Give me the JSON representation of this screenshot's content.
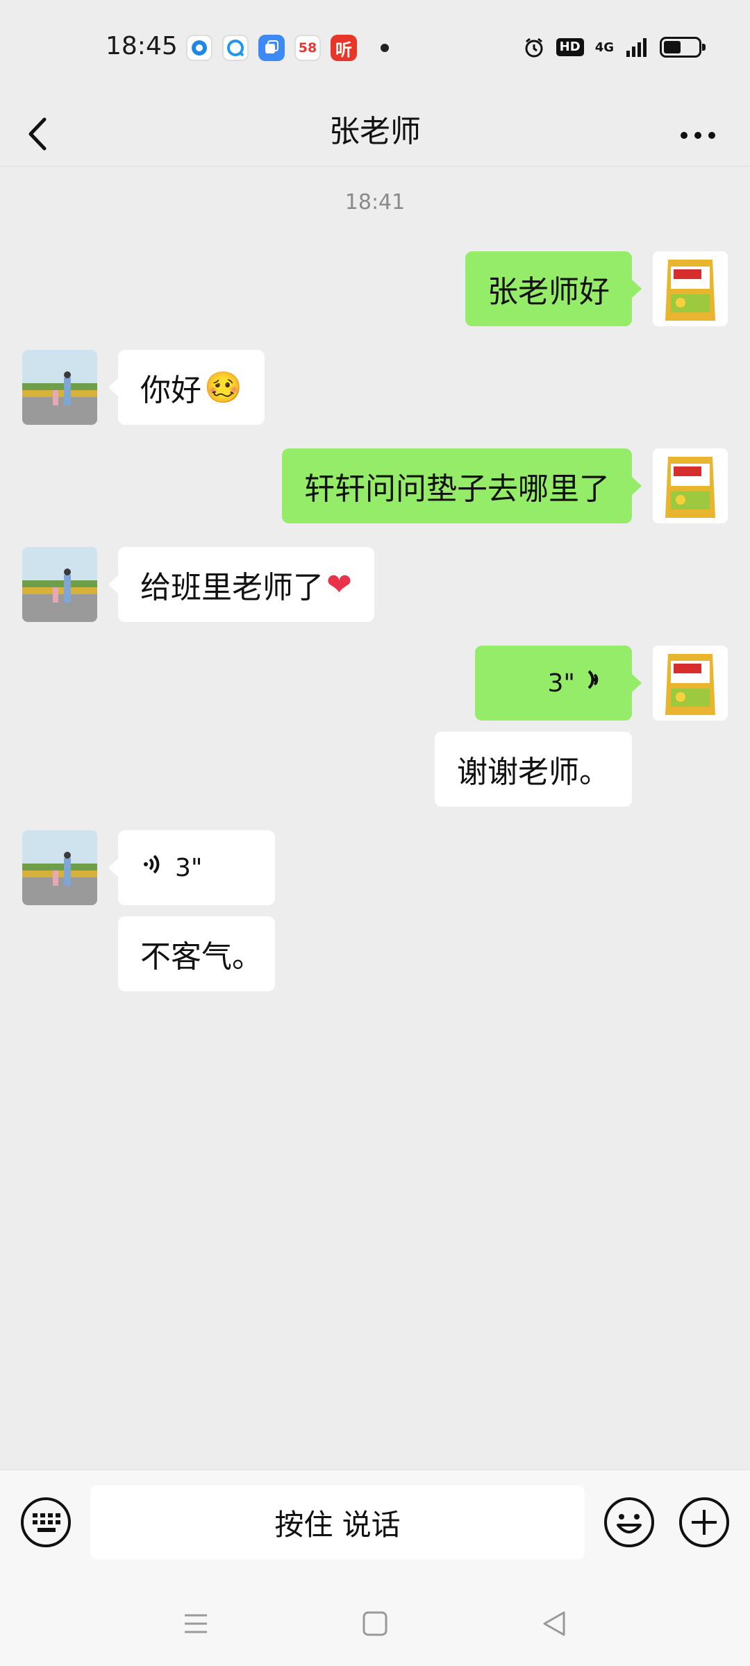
{
  "status_bar": {
    "time": "18:45",
    "apps": [
      "58",
      "听"
    ],
    "network": "4G"
  },
  "header": {
    "title": "张老师"
  },
  "chat": {
    "timestamp": "18:41",
    "messages": [
      {
        "from": "me",
        "type": "text",
        "text": "张老师好"
      },
      {
        "from": "other",
        "type": "text",
        "text": "你好",
        "emoji": "🥴"
      },
      {
        "from": "me",
        "type": "text",
        "text": "轩轩问问垫子去哪里了"
      },
      {
        "from": "other",
        "type": "text",
        "text": "给班里老师了",
        "emoji": "❤"
      },
      {
        "from": "me",
        "type": "voice",
        "duration": "3\""
      },
      {
        "from": "me",
        "type": "voice-transcript",
        "text": "谢谢老师。"
      },
      {
        "from": "other",
        "type": "voice",
        "duration": "3\""
      },
      {
        "from": "other",
        "type": "voice-transcript",
        "text": "不客气。"
      }
    ]
  },
  "input_bar": {
    "hold_to_talk": "按住 说话"
  },
  "colors": {
    "my_bubble": "#95ec69",
    "other_bubble": "#ffffff",
    "background": "#ededed"
  }
}
